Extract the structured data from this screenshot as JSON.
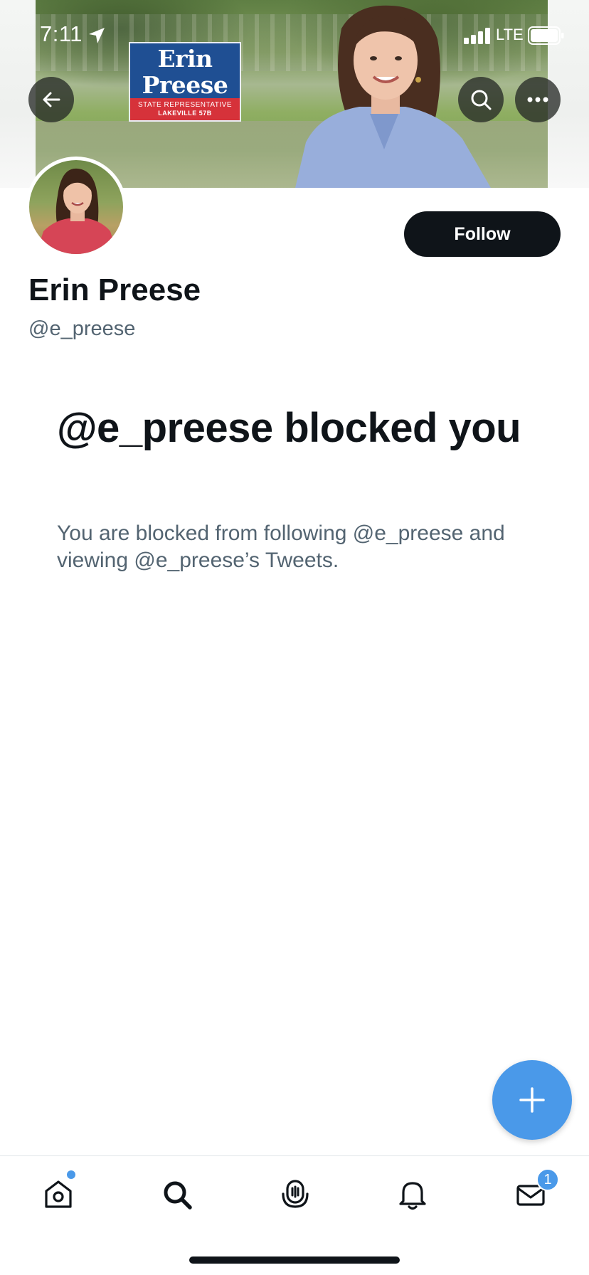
{
  "status_bar": {
    "time": "7:11",
    "network": "LTE"
  },
  "banner": {
    "sign_name_line1": "Erin",
    "sign_name_line2": "Preese",
    "sign_title": "STATE REPRESENTATIVE",
    "sign_district": "LAKEVILLE 57B"
  },
  "header_icons": {
    "back": "back-arrow-icon",
    "search": "search-icon",
    "more": "more-icon"
  },
  "profile": {
    "display_name": "Erin Preese",
    "handle": "@e_preese",
    "follow_label": "Follow"
  },
  "blocked": {
    "title": "@e_preese blocked you",
    "description": "You are blocked from following @e_preese and viewing @e_preese’s Tweets."
  },
  "tabbar": {
    "items": [
      {
        "icon": "home-icon",
        "has_dot": true
      },
      {
        "icon": "search-icon"
      },
      {
        "icon": "spaces-icon"
      },
      {
        "icon": "notifications-icon"
      },
      {
        "icon": "messages-icon",
        "badge": "1"
      }
    ]
  },
  "colors": {
    "accent": "#4a99e9",
    "text_primary": "#0f1419",
    "text_secondary": "#536471",
    "sign_blue": "#1f4f93",
    "sign_red": "#d6323a"
  }
}
